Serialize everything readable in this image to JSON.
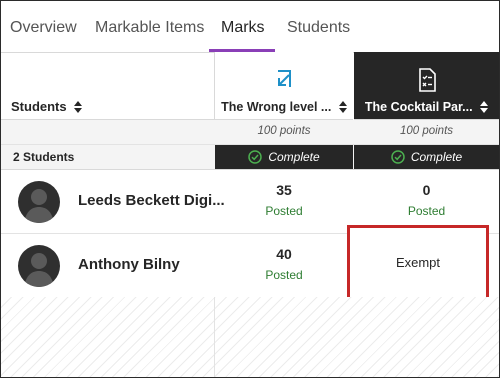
{
  "tabs": [
    {
      "label": "Overview"
    },
    {
      "label": "Markable Items"
    },
    {
      "label": "Marks"
    },
    {
      "label": "Students"
    }
  ],
  "table": {
    "students_header": "Students",
    "student_count": "2 Students",
    "columns": [
      {
        "title": "The Wrong level ...",
        "points": "100 points",
        "status": "Complete"
      },
      {
        "title": "The Cocktail Par...",
        "points": "100 points",
        "status": "Complete"
      }
    ],
    "rows": [
      {
        "name": "Leeds Beckett Digi...",
        "grades": [
          {
            "value": "35",
            "status": "Posted"
          },
          {
            "value": "0",
            "status": "Posted"
          }
        ]
      },
      {
        "name": "Anthony Bilny",
        "grades": [
          {
            "value": "40",
            "status": "Posted"
          },
          {
            "value": "Exempt",
            "status": ""
          }
        ]
      }
    ]
  },
  "colors": {
    "accent": "#8a3fb7",
    "header_dark": "#262626",
    "posted": "#2e7d32",
    "highlight": "#c62828",
    "icon_blue": "#1e90c8"
  }
}
